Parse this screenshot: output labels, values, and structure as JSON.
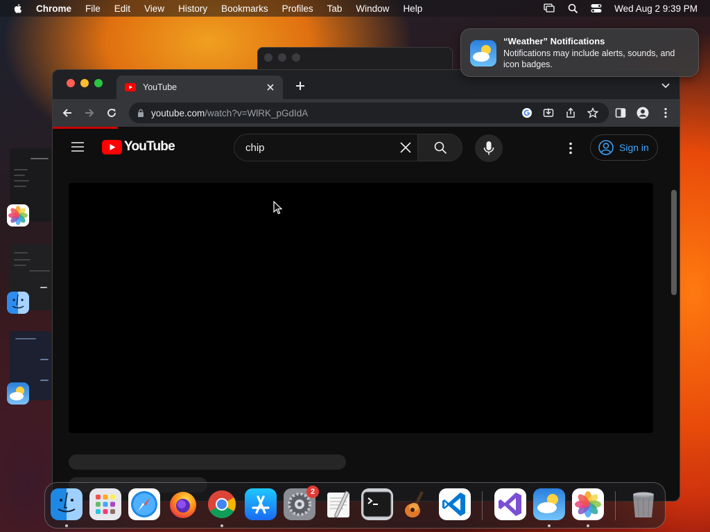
{
  "menubar": {
    "app_name": "Chrome",
    "items": [
      "File",
      "Edit",
      "View",
      "History",
      "Bookmarks",
      "Profiles",
      "Tab",
      "Window",
      "Help"
    ],
    "clock": "Wed Aug 2  9:39 PM"
  },
  "browser": {
    "tab_title": "YouTube",
    "url_host": "youtube.com",
    "url_path": "/watch?v=WlRK_pGdIdA"
  },
  "youtube": {
    "logo_text": "YouTube",
    "search_value": "chip",
    "signin_label": "Sign in"
  },
  "notification": {
    "title": "“Weather” Notifications",
    "body": "Notifications may include alerts, sounds, and icon badges."
  },
  "dock": {
    "apps": [
      "Finder",
      "Launchpad",
      "Safari",
      "Firefox",
      "Google Chrome",
      "App Store",
      "System Settings",
      "TextEdit",
      "Terminal",
      "GarageBand",
      "Visual Studio Code",
      "Visual Studio",
      "Weather",
      "Photos",
      "Trash"
    ],
    "settings_badge": "2"
  },
  "colors": {
    "youtube_red": "#ff0000",
    "link_blue": "#3ea6ff",
    "progress_red": "#cc0000"
  }
}
